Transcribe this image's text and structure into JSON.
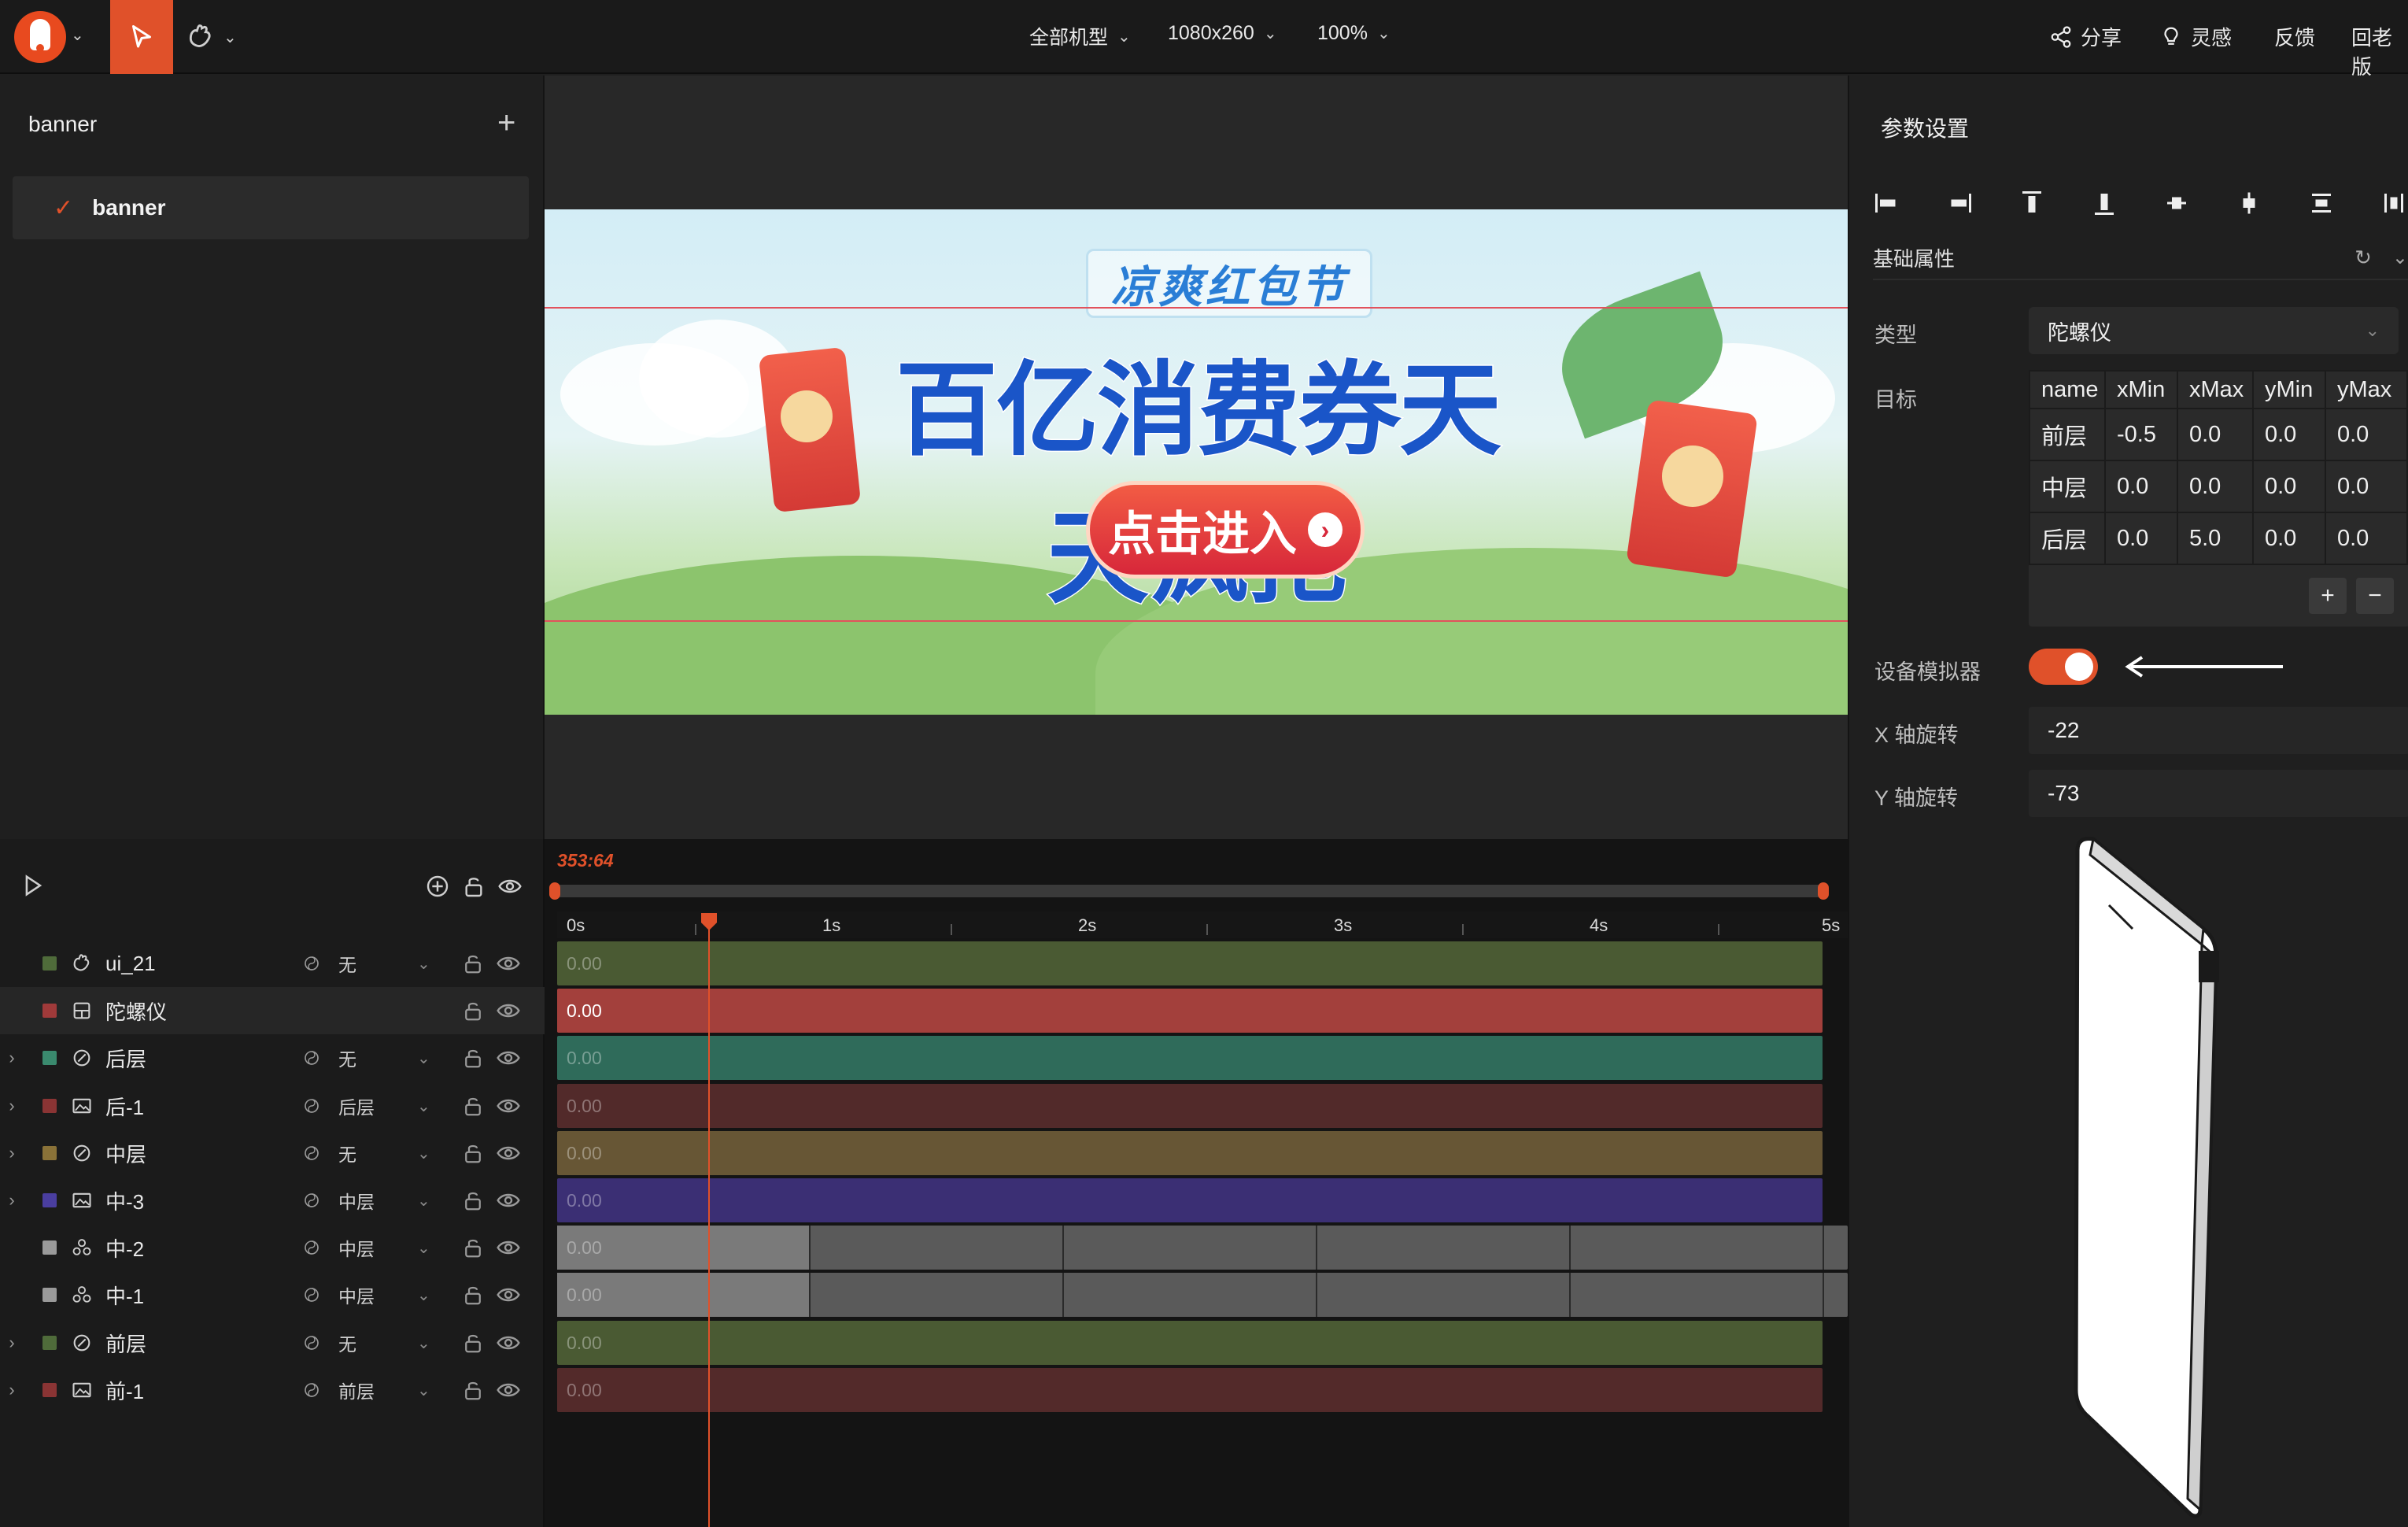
{
  "topbar": {
    "device": "全部机型",
    "resolution": "1080x260",
    "zoom": "100%",
    "share": "分享",
    "inspiration": "灵感",
    "feedback": "反馈",
    "old_version": "回老版"
  },
  "layers_panel": {
    "title": "banner",
    "items": [
      {
        "label": "banner"
      }
    ]
  },
  "banner_art": {
    "subtitle": "凉爽红包节",
    "headline": "百亿消费券天天疯抢",
    "cta": "点击进入"
  },
  "right_panel": {
    "title": "参数设置",
    "section": "基础属性",
    "type_label": "类型",
    "type_value": "陀螺仪",
    "target_label": "目标",
    "target_table": {
      "headers": [
        "name",
        "xMin",
        "xMax",
        "yMin",
        "yMax"
      ],
      "rows": [
        [
          "前层",
          "-0.5",
          "0.0",
          "0.0",
          "0.0"
        ],
        [
          "中层",
          "0.0",
          "0.0",
          "0.0",
          "0.0"
        ],
        [
          "后层",
          "0.0",
          "5.0",
          "0.0",
          "0.0"
        ]
      ]
    },
    "add_symbol": "+",
    "remove_symbol": "−",
    "simulator_label": "设备模拟器",
    "simulator_on": true,
    "x_rot_label": "X 轴旋转",
    "x_rot_value": "-22",
    "y_rot_label": "Y 轴旋转",
    "y_rot_value": "-73"
  },
  "timeline": {
    "current_time": "353:64",
    "ticks": [
      "0s",
      "1s",
      "2s",
      "3s",
      "4s",
      "5s"
    ],
    "layers": [
      {
        "name": "ui_21",
        "blend": "无",
        "color": "#4f6b3a",
        "value": "0.00",
        "track": "#4a5a33",
        "icon": "hand",
        "expand": false,
        "selected": false
      },
      {
        "name": "陀螺仪",
        "blend": "",
        "color": "#a03a3a",
        "value": "0.00",
        "track": "#a3403c",
        "icon": "gyro",
        "expand": false,
        "selected": true
      },
      {
        "name": "后层",
        "blend": "无",
        "color": "#3a8a6e",
        "value": "0.00",
        "track": "#2f6b5a",
        "icon": "circle",
        "expand": true,
        "selected": false
      },
      {
        "name": "后-1",
        "blend": "后层",
        "color": "#8a3434",
        "value": "0.00",
        "track": "#522a2a",
        "icon": "image",
        "expand": true,
        "selected": false
      },
      {
        "name": "中层",
        "blend": "无",
        "color": "#8a7238",
        "value": "0.00",
        "track": "#675635",
        "icon": "circle",
        "expand": true,
        "selected": false
      },
      {
        "name": "中-3",
        "blend": "中层",
        "color": "#4a3ea0",
        "value": "0.00",
        "track": "#3b2f74",
        "icon": "image",
        "expand": true,
        "selected": false
      },
      {
        "name": "中-2",
        "blend": "中层",
        "color": "#9a9a9a",
        "value": "0.00",
        "track": "#5a5a5a",
        "icon": "shapes",
        "expand": false,
        "selected": false
      },
      {
        "name": "中-1",
        "blend": "中层",
        "color": "#9a9a9a",
        "value": "0.00",
        "track": "#5a5a5a",
        "icon": "shapes",
        "expand": false,
        "selected": false
      },
      {
        "name": "前层",
        "blend": "无",
        "color": "#4f6b3a",
        "value": "0.00",
        "track": "#4a5a33",
        "icon": "circle",
        "expand": true,
        "selected": false
      },
      {
        "name": "前-1",
        "blend": "前层",
        "color": "#8a3434",
        "value": "0.00",
        "track": "#532a2a",
        "icon": "image",
        "expand": true,
        "selected": false
      }
    ]
  },
  "colors": {
    "accent": "#e0512a",
    "bg": "#1f1f1f",
    "panel": "#2a2a2a"
  }
}
